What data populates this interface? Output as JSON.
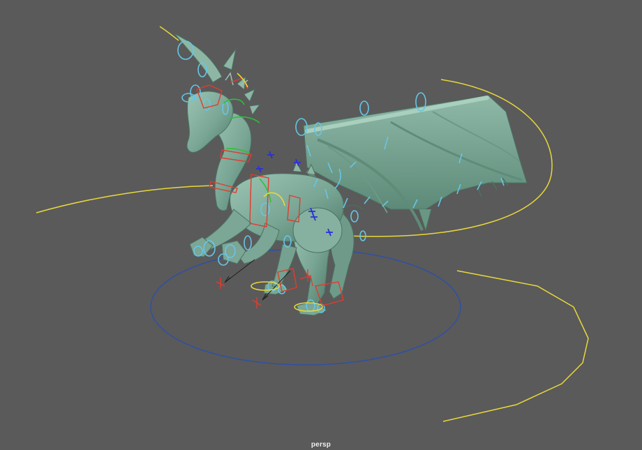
{
  "viewport": {
    "camera_label": "persp",
    "background_color": "#5a5a5a"
  },
  "scene": {
    "model": "dragon-mesh",
    "model_color": "#7fa998",
    "controls": {
      "fk_color": "#66c6e6",
      "curve_color": "#e8d83a",
      "ik_color": "#e33b2e",
      "main_ctrl_color": "#2d4fa8",
      "pole_color": "#2a2fd8",
      "neck_color": "#29c23a"
    }
  }
}
